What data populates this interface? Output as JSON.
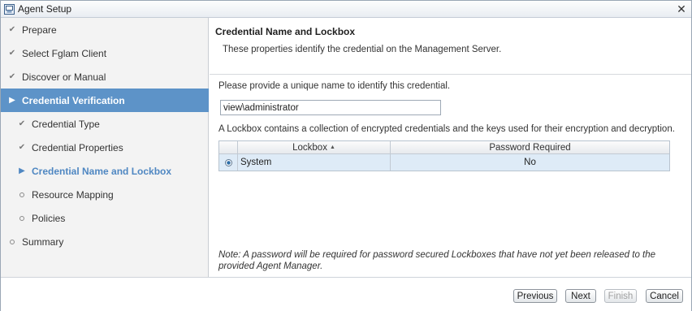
{
  "window": {
    "title": "Agent Setup",
    "close_glyph": "✕",
    "icon": "agent-setup-icon"
  },
  "nav": {
    "items": [
      {
        "label": "Prepare",
        "state": "done"
      },
      {
        "label": "Select Fglam Client",
        "state": "done"
      },
      {
        "label": "Discover or Manual",
        "state": "done"
      },
      {
        "label": "Credential Verification",
        "state": "active"
      },
      {
        "label": "Credential Type",
        "state": "done"
      },
      {
        "label": "Credential Properties",
        "state": "done"
      },
      {
        "label": "Credential Name and Lockbox",
        "state": "current"
      },
      {
        "label": "Resource Mapping",
        "state": "pending"
      },
      {
        "label": "Policies",
        "state": "pending"
      },
      {
        "label": "Summary",
        "state": "pending"
      }
    ]
  },
  "main": {
    "title": "Credential Name and Lockbox",
    "subtitle": "These properties identify the credential on the Management Server.",
    "name_prompt": "Please provide a unique name to identify this credential.",
    "name_value": "view\\administrator",
    "lockbox_description": "A Lockbox contains a collection of encrypted credentials and the keys used for their encryption and decryption.",
    "grid": {
      "columns": [
        "Lockbox",
        "Password Required"
      ],
      "sort_indicator": "▲",
      "rows": [
        {
          "lockbox": "System",
          "password_required": "No",
          "selected": true
        }
      ]
    },
    "note": "Note: A password will be required for password secured Lockboxes that have not yet been released to the provided Agent Manager."
  },
  "footer": {
    "previous": "Previous",
    "next": "Next",
    "finish": "Finish",
    "cancel": "Cancel"
  },
  "colors": {
    "active_nav_bg": "#5d93c8",
    "current_nav_text": "#4f87c2",
    "selected_row_bg": "#deebf7"
  }
}
